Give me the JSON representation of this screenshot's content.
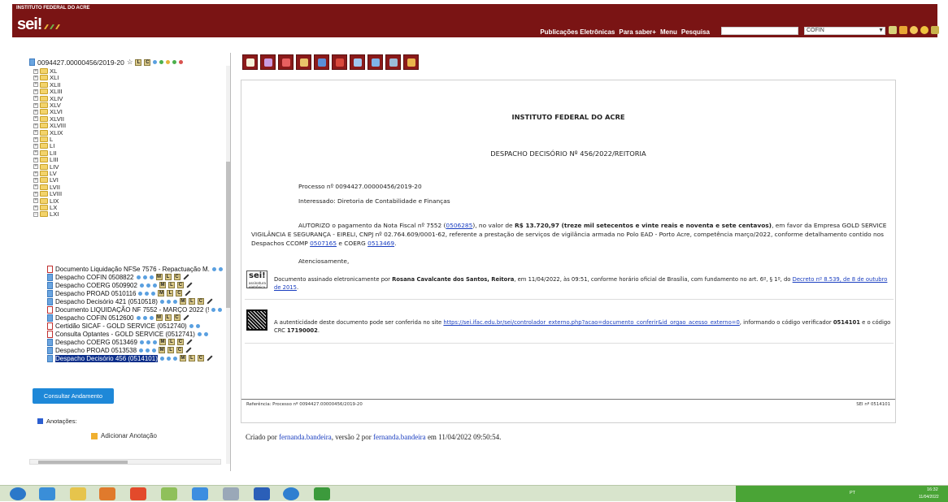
{
  "header": {
    "institution": "INSTITUTO FEDERAL DO ACRE",
    "logo": "sei!",
    "menu": [
      "Publicações Eletrônicas",
      "Para saber+",
      "Menu",
      "Pesquisa"
    ],
    "unit": "COFIN",
    "icons": [
      "list-icon",
      "bell-icon",
      "user-icon",
      "star-icon",
      "exit-icon"
    ]
  },
  "tree": {
    "process": "0094427.00000456/2019-20",
    "folders": [
      "XL",
      "XLI",
      "XLII",
      "XLIII",
      "XLIV",
      "XLV",
      "XLVI",
      "XLVII",
      "XLVIII",
      "XLIX",
      "L",
      "LI",
      "LII",
      "LIII",
      "LIV",
      "LV",
      "LVI",
      "LVII",
      "LVIII",
      "LIX",
      "LX",
      "LXI"
    ],
    "documents": [
      {
        "label": "Documento Liquidação NFSe 7576 - Repactuação M.",
        "type": "pdf"
      },
      {
        "label": "Despacho COFIN 0508822",
        "type": "doc"
      },
      {
        "label": "Despacho COERG 0509902",
        "type": "doc"
      },
      {
        "label": "Despacho PROAD 0510116",
        "type": "doc"
      },
      {
        "label": "Despacho Decisório 421 (0510518)",
        "type": "doc"
      },
      {
        "label": "Documento LIQUIDAÇÃO NF 7552 - MARÇO 2022 (!",
        "type": "pdf"
      },
      {
        "label": "Despacho COFIN 0512600",
        "type": "doc"
      },
      {
        "label": "Certidão SICAF - GOLD SERVICE (0512740)",
        "type": "pdf"
      },
      {
        "label": "Consulta Optantes - GOLD SERVICE (0512741)",
        "type": "pdf"
      },
      {
        "label": "Despacho COERG 0513469",
        "type": "doc"
      },
      {
        "label": "Despacho PROAD 0513538",
        "type": "doc"
      },
      {
        "label": "Despacho Decisório 456 (0514101)",
        "type": "doc",
        "selected": true
      }
    ],
    "consultar_button": "Consultar Andamento",
    "anotacoes_label": "Anotações:",
    "add_anotacao": "Adicionar Anotação"
  },
  "document": {
    "institution": "INSTITUTO FEDERAL DO ACRE",
    "title": "DESPACHO DECISÓRIO Nº 456/2022/REITORIA",
    "processo": "Processo nº 0094427.00000456/2019-20",
    "interessado": "Interessado: Diretoria de Contabilidade e Finanças",
    "body_1": "AUTORIZO o pagamento da Nota Fiscal nº 7552 (",
    "body_link_1": "0506285",
    "body_2": "), no valor de ",
    "body_bold": "R$ 13.720,97 (treze mil setecentos e vinte reais e noventa e sete centavos)",
    "body_3": ", em favor da Empresa GOLD SERVICE VIGILÂNCIA E SEGURANÇA - EIRELI, CNPJ nº 02.764.609/0001-62, referente a prestação de serviços de vigilância armada no Polo EAD - Porto Acre, competência março/2022, conforme detalhamento contido nos Despachos CCOMP ",
    "body_link_2": "0507165",
    "body_4": " e COERG ",
    "body_link_3": "0513469",
    "body_5": ".",
    "closing": "Atenciosamente,",
    "sig_1": "Documento assinado eletronicamente por ",
    "sig_bold": "Rosana Cavalcante dos Santos, Reitora",
    "sig_2": ", em 11/04/2022, às 09:51, conforme horário oficial de Brasília, com fundamento no art. 6º, § 1º, do ",
    "sig_link": "Decreto nº 8.539, de 8 de outubro de 2015",
    "sig_3": ".",
    "badge_sub": "assinatura eletrônica",
    "auth_1": "A autenticidade deste documento pode ser conferida no site ",
    "auth_link": "https://sei.ifac.edu.br/sei/controlador_externo.php?acao=documento_conferir&id_orgao_acesso_externo=0",
    "auth_2": ", informando o código verificador ",
    "auth_code": "0514101",
    "auth_3": " e o código CRC ",
    "auth_crc": "17190002",
    "auth_4": ".",
    "ref_left": "Referência: Processo nº 0094427.00000456/2019-20",
    "ref_right": "SEI nº 0514101"
  },
  "created": {
    "pre": "Criado por ",
    "user1": "fernanda.bandeira",
    "mid": ", versão 2 por ",
    "user2": "fernanda.bandeira",
    "post": " em 11/04/2022 09:50:54."
  },
  "taskbar": {
    "lang": "PT",
    "time": "16:32",
    "date": "11/04/2022"
  },
  "colors": {
    "header": "#7a1414",
    "selection": "#0b2e8a",
    "button": "#1e88d8",
    "taskbar": "#d8e4cc"
  }
}
